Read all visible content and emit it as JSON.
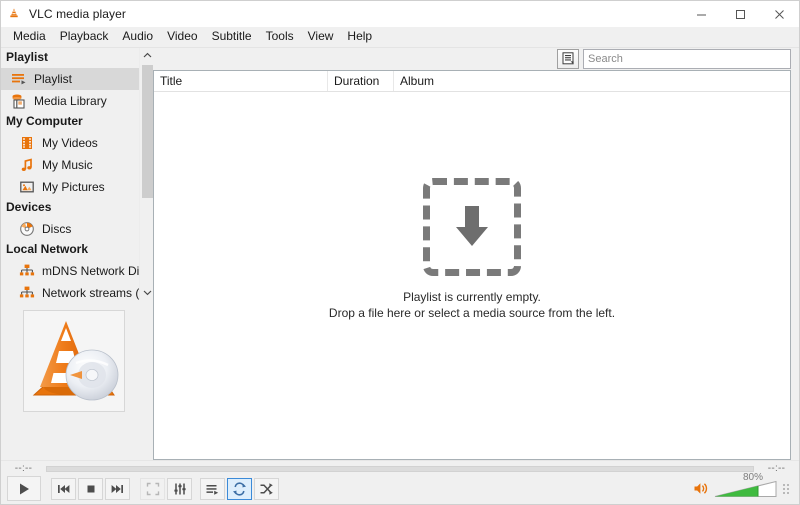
{
  "window": {
    "title": "VLC media player",
    "app_icon": "vlc-cone-icon",
    "minimize_label": "Minimize",
    "maximize_label": "Maximize",
    "close_label": "Close"
  },
  "menubar": {
    "items": [
      {
        "label": "Media",
        "name": "menu-media"
      },
      {
        "label": "Playback",
        "name": "menu-playback"
      },
      {
        "label": "Audio",
        "name": "menu-audio"
      },
      {
        "label": "Video",
        "name": "menu-video"
      },
      {
        "label": "Subtitle",
        "name": "menu-subtitle"
      },
      {
        "label": "Tools",
        "name": "menu-tools"
      },
      {
        "label": "View",
        "name": "menu-view"
      },
      {
        "label": "Help",
        "name": "menu-help"
      }
    ]
  },
  "sidebar": {
    "groups": [
      {
        "title": "Playlist",
        "items": [
          {
            "label": "Playlist",
            "icon": "playlist-icon",
            "selected": true
          },
          {
            "label": "Media Library",
            "icon": "media-library-icon",
            "selected": false
          }
        ]
      },
      {
        "title": "My Computer",
        "items": [
          {
            "label": "My Videos",
            "icon": "film-strip-icon",
            "selected": false
          },
          {
            "label": "My Music",
            "icon": "music-note-icon",
            "selected": false
          },
          {
            "label": "My Pictures",
            "icon": "picture-icon",
            "selected": false
          }
        ]
      },
      {
        "title": "Devices",
        "items": [
          {
            "label": "Discs",
            "icon": "disc-icon",
            "selected": false
          }
        ]
      },
      {
        "title": "Local Network",
        "items": [
          {
            "label": "mDNS Network Disco...",
            "icon": "network-icon",
            "selected": false
          },
          {
            "label": "Network streams (SAP)",
            "icon": "network-icon",
            "selected": false
          }
        ]
      }
    ],
    "scroll_up_label": "Scroll up",
    "scroll_down_label": "Scroll down",
    "cover_art_alt": "VLC traffic cone and disc artwork"
  },
  "main": {
    "view_toggle_label": "Change playlist view mode",
    "search": {
      "placeholder": "Search",
      "value": ""
    },
    "columns": [
      {
        "label": "Title",
        "name": "column-title"
      },
      {
        "label": "Duration",
        "name": "column-duration"
      },
      {
        "label": "Album",
        "name": "column-album"
      }
    ],
    "empty_state": {
      "icon": "download-arrow-icon",
      "line1": "Playlist is currently empty.",
      "line2": "Drop a file here or select a media source from the left."
    }
  },
  "transport": {
    "elapsed_time": "--:--",
    "total_time": "--:--",
    "seek_position_percent": 0,
    "buttons": [
      {
        "name": "play-button",
        "label": "Play",
        "state": "normal"
      },
      {
        "name": "previous-button",
        "label": "Previous",
        "state": "normal"
      },
      {
        "name": "stop-button",
        "label": "Stop",
        "state": "normal"
      },
      {
        "name": "next-button",
        "label": "Next",
        "state": "normal"
      },
      {
        "name": "fullscreen-button",
        "label": "Toggle fullscreen",
        "state": "disabled"
      },
      {
        "name": "equalizer-button",
        "label": "Show extended settings",
        "state": "normal"
      },
      {
        "name": "playlist-toggle-button",
        "label": "Toggle playlist",
        "state": "normal"
      },
      {
        "name": "loop-button",
        "label": "Click to toggle between loop all, loop one and no loop",
        "state": "active"
      },
      {
        "name": "shuffle-button",
        "label": "Random",
        "state": "normal"
      }
    ],
    "volume": {
      "percent_label": "80%",
      "value": 80,
      "mute_icon": "speaker-icon"
    }
  },
  "colors": {
    "accent_orange": "#e8740c",
    "volume_green": "#3fba3f",
    "active_blue": "#3b8ad8",
    "window_bg": "#f0f0f0",
    "panel_bg": "#ffffff"
  }
}
